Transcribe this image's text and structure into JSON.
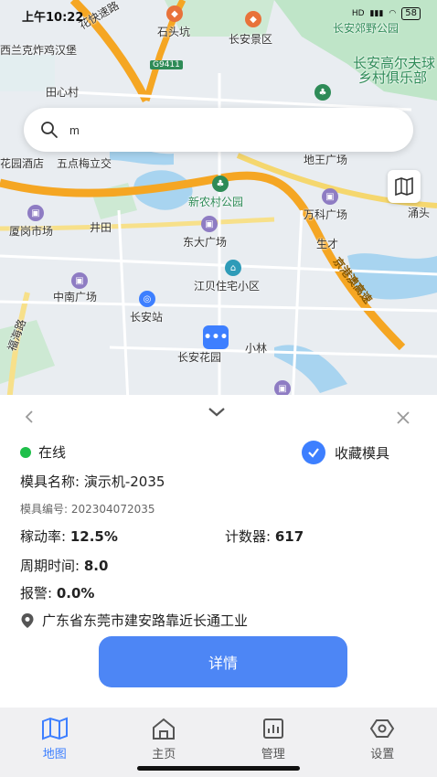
{
  "status_bar": {
    "time": "上午10:22",
    "network": "HD",
    "battery": "58"
  },
  "map": {
    "labels": {
      "l1": "长安郊野公园",
      "l2": "石头坑",
      "l3": "长安景区",
      "l4": "西兰克炸鸡汉堡",
      "l5": "G9411",
      "l6": "长安高尔夫球",
      "l7": "乡村俱乐部",
      "l8": "田心村",
      "l9": "花园酒店",
      "l10": "五点梅立交",
      "l11": "地王广场",
      "l12": "新农村公园",
      "l13": "万科广场",
      "l14": "涌头",
      "l15": "井田",
      "l16": "厦岗市场",
      "l17": "东大广场",
      "l18": "生才",
      "l19": "江贝住宅小区",
      "l20": "中南广场",
      "l21": "长安站",
      "l22": "长安花园",
      "l23": "小林",
      "l24": "京港澳高速",
      "l25": "福海路",
      "l26": "花快速路"
    }
  },
  "search": {
    "value": "m"
  },
  "panel": {
    "status": "在线",
    "favorite_label": "收藏模具",
    "mold_name_label": "模具名称:",
    "mold_name": "演示机-2035",
    "mold_no_label": "模具编号:",
    "mold_no": "202304072035",
    "move_rate_label": "稼动率:",
    "move_rate": "12.5%",
    "counter_label": "计数器:",
    "counter": "617",
    "cycle_label": "周期时间:",
    "cycle": "8.0",
    "alarm_label": "报警:",
    "alarm": "0.0%",
    "address": "广东省东莞市建安路靠近长通工业",
    "detail_button": "详情"
  },
  "tabs": [
    {
      "label": "地图",
      "icon": "map-icon",
      "active": true
    },
    {
      "label": "主页",
      "icon": "home-icon",
      "active": false
    },
    {
      "label": "管理",
      "icon": "chart-icon",
      "active": false
    },
    {
      "label": "设置",
      "icon": "settings-icon",
      "active": false
    }
  ],
  "colors": {
    "accent": "#3d7fff",
    "online": "#1fbf4a",
    "button": "#4d86f5",
    "road_major": "#f5a623"
  }
}
